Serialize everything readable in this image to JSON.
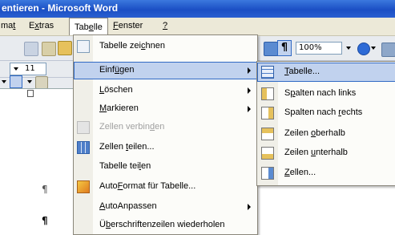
{
  "window": {
    "title": "entieren - Microsoft Word"
  },
  "menubar": {
    "items": [
      {
        "pre": "ma",
        "u": "t",
        "post": ""
      },
      {
        "pre": "E",
        "u": "x",
        "post": "tras"
      },
      {
        "pre": "Tab",
        "u": "e",
        "post": "lle"
      },
      {
        "pre": "",
        "u": "F",
        "post": "enster"
      },
      {
        "pre": "",
        "u": "?",
        "post": ""
      }
    ]
  },
  "toolbar": {
    "zoom": "100%",
    "font_size": "11",
    "pilcrow": "¶"
  },
  "document": {
    "pilcrow": "¶"
  },
  "table_menu": {
    "items": [
      {
        "pre": "Tabelle zei",
        "u": "c",
        "post": "hnen",
        "disabled": false,
        "submenu": false
      },
      {
        "pre": "Einf",
        "u": "ü",
        "post": "gen",
        "disabled": false,
        "submenu": true,
        "highlighted": true
      },
      {
        "pre": "",
        "u": "L",
        "post": "öschen",
        "disabled": false,
        "submenu": true
      },
      {
        "pre": "",
        "u": "M",
        "post": "arkieren",
        "disabled": false,
        "submenu": true
      },
      {
        "pre": "Zellen verbin",
        "u": "d",
        "post": "en",
        "disabled": true,
        "submenu": false
      },
      {
        "pre": "Zellen ",
        "u": "t",
        "post": "eilen...",
        "disabled": false,
        "submenu": false
      },
      {
        "pre": "Tabelle tei",
        "u": "l",
        "post": "en",
        "disabled": false,
        "submenu": false
      },
      {
        "pre": "Auto",
        "u": "F",
        "post": "ormat für Tabelle...",
        "disabled": false,
        "submenu": false
      },
      {
        "pre": "",
        "u": "A",
        "post": "utoAnpassen",
        "disabled": false,
        "submenu": true
      },
      {
        "pre": "Ü",
        "u": "b",
        "post": "erschriftenzeilen wiederholen",
        "disabled": false,
        "submenu": false
      }
    ]
  },
  "insert_submenu": {
    "items": [
      {
        "pre": "",
        "u": "T",
        "post": "abelle...",
        "highlighted": true
      },
      {
        "pre": "S",
        "u": "p",
        "post": "alten nach links"
      },
      {
        "pre": "Spalten nach ",
        "u": "r",
        "post": "echts"
      },
      {
        "pre": "Zeilen ",
        "u": "o",
        "post": "berhalb"
      },
      {
        "pre": "Zeilen ",
        "u": "u",
        "post": "nterhalb"
      },
      {
        "pre": "",
        "u": "Z",
        "post": "ellen..."
      }
    ]
  }
}
